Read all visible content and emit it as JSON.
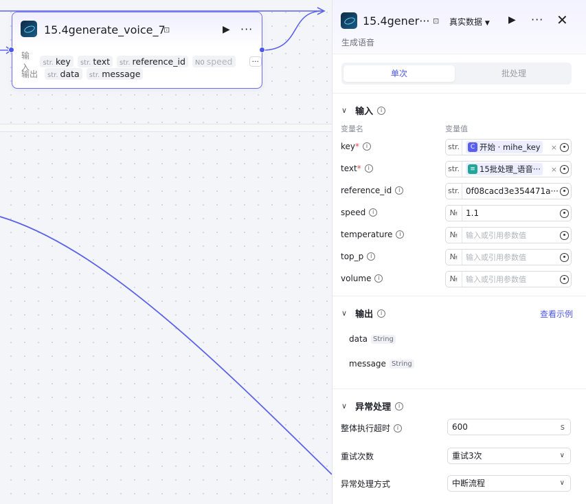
{
  "node": {
    "title": "15.4generate_voice_7",
    "input_label": "输入",
    "output_label": "输出",
    "inputs": [
      {
        "type": "str.",
        "name": "key"
      },
      {
        "type": "str.",
        "name": "text"
      },
      {
        "type": "str.",
        "name": "reference_id"
      },
      {
        "type": "N0",
        "name": "speed"
      }
    ],
    "outputs": [
      {
        "type": "str.",
        "name": "data"
      },
      {
        "type": "str.",
        "name": "message"
      }
    ],
    "more": "···"
  },
  "panel": {
    "title": "15.4gener···",
    "mode": "真实数据",
    "subtitle": "生成语音",
    "tabs": [
      {
        "label": "单次"
      },
      {
        "label": "批处理"
      }
    ],
    "input_section": {
      "title": "输入",
      "col_name": "变量名",
      "col_value": "变量值",
      "params": [
        {
          "name": "key",
          "required": true,
          "type": "str.",
          "ref_source": "开始 · mihe_key",
          "ref_icon": "C"
        },
        {
          "name": "text",
          "required": true,
          "type": "str.",
          "ref_source": "15批处理_语音···",
          "ref_icon": "≡"
        },
        {
          "name": "reference_id",
          "required": false,
          "type": "str.",
          "value": "0f08cacd3e354471a···"
        },
        {
          "name": "speed",
          "required": false,
          "type": "№",
          "value": "1.1"
        },
        {
          "name": "temperature",
          "required": false,
          "type": "№",
          "placeholder": "输入或引用参数值"
        },
        {
          "name": "top_p",
          "required": false,
          "type": "№",
          "placeholder": "输入或引用参数值"
        },
        {
          "name": "volume",
          "required": false,
          "type": "№",
          "placeholder": "输入或引用参数值"
        }
      ]
    },
    "output_section": {
      "title": "输出",
      "example_link": "查看示例",
      "items": [
        {
          "name": "data",
          "type": "String"
        },
        {
          "name": "message",
          "type": "String"
        }
      ]
    },
    "error_section": {
      "title": "异常处理",
      "timeout_label": "整体执行超时",
      "timeout_value": "600",
      "timeout_unit": "s",
      "retry_label": "重试次数",
      "retry_value": "重试3次",
      "mode_label": "异常处理方式",
      "mode_value": "中断流程"
    }
  },
  "colors": {
    "accent": "#4c58e8",
    "edge": "#5b63ea"
  }
}
